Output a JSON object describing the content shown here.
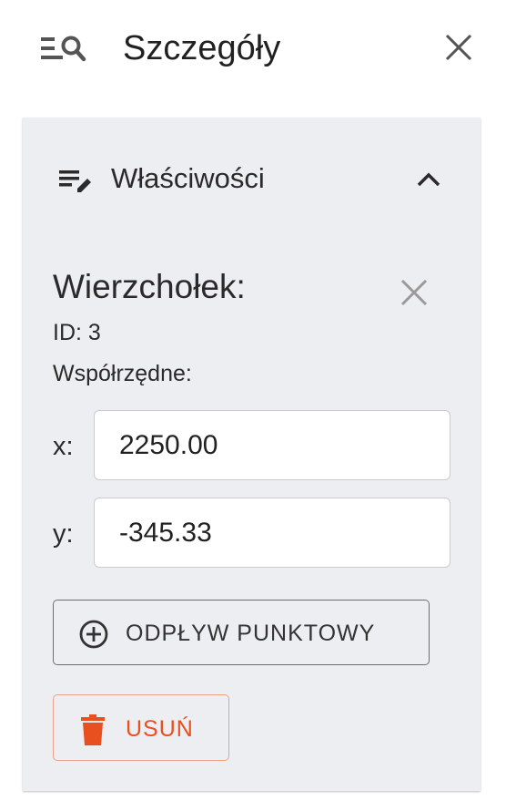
{
  "header": {
    "title": "Szczegóły",
    "icon": "manage-search-icon",
    "close_icon": "close-icon"
  },
  "section": {
    "title": "Właściwości",
    "icon": "edit-note-icon",
    "chevron_icon": "chevron-up-icon",
    "expanded": true
  },
  "vertex": {
    "title": "Wierzchołek:",
    "id_text": "ID: 3",
    "coords_label": "Współrzędne:",
    "x_label": "x:",
    "x_value": "2250.00",
    "y_label": "y:",
    "y_value": "-345.33",
    "close_icon": "close-icon"
  },
  "actions": {
    "add_outflow_label": "ODPŁYW PUNKTOWY",
    "add_outflow_icon": "add-circle-outline-icon",
    "delete_label": "USUŃ",
    "delete_icon": "trash-icon"
  },
  "colors": {
    "panel_background": "#eceef2",
    "danger": "#e8501f",
    "danger_border": "#efa089",
    "icon_gray": "#555555"
  }
}
